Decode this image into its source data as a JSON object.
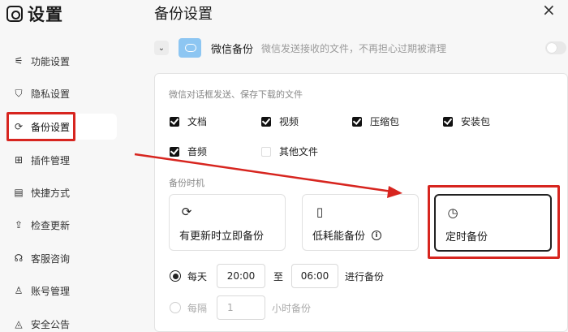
{
  "app": {
    "title": "设置"
  },
  "sidebar": {
    "items": [
      {
        "label": "功能设置",
        "icon": "sliders-icon"
      },
      {
        "label": "隐私设置",
        "icon": "shield-icon"
      },
      {
        "label": "备份设置",
        "icon": "refresh-icon",
        "active": true
      },
      {
        "label": "插件管理",
        "icon": "grid-icon"
      },
      {
        "label": "快捷方式",
        "icon": "window-icon"
      },
      {
        "label": "检查更新",
        "icon": "update-icon"
      },
      {
        "label": "客服咨询",
        "icon": "headset-icon"
      },
      {
        "label": "账号管理",
        "icon": "user-icon"
      },
      {
        "label": "安全公告",
        "icon": "megaphone-icon"
      }
    ]
  },
  "main": {
    "title": "备份设置",
    "close": "×",
    "wechat_backup": {
      "name": "微信备份",
      "desc": "微信发送接收的文件，不再担心过期被清理",
      "toggle_on": false
    },
    "file_types_label": "微信对话框发送、保存下载的文件",
    "file_types": [
      {
        "label": "文档",
        "checked": true
      },
      {
        "label": "视频",
        "checked": true
      },
      {
        "label": "压缩包",
        "checked": true
      },
      {
        "label": "安装包",
        "checked": true
      },
      {
        "label": "音频",
        "checked": true
      },
      {
        "label": "其他文件",
        "checked": false
      }
    ],
    "timing_label": "备份时机",
    "timing_options": [
      {
        "label": "有更新时立即备份",
        "icon": "refresh-icon"
      },
      {
        "label": "低耗能备份",
        "icon": "battery-icon",
        "info": "i"
      },
      {
        "label": "定时备份",
        "icon": "clock-icon",
        "selected": true
      }
    ],
    "schedule": {
      "daily_label": "每天",
      "start": "20:00",
      "to": "至",
      "end": "06:00",
      "suffix": "进行备份",
      "interval_label": "每隔",
      "interval_value": "1",
      "interval_suffix": "小时备份"
    }
  },
  "colors": {
    "highlight": "#d7251f",
    "accent": "#111111"
  }
}
